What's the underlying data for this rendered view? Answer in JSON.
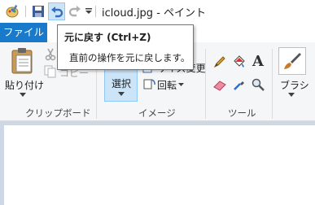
{
  "window": {
    "title": "icloud.jpg - ペイント"
  },
  "quick_access": {
    "icons": [
      "paint-app-icon",
      "save-icon",
      "undo-icon",
      "redo-icon",
      "customize-dropdown-icon"
    ]
  },
  "tabs": {
    "file_label": "ファイル"
  },
  "tooltip": {
    "title": "元に戻す (Ctrl+Z)",
    "description": "直前の操作を元に戻します。"
  },
  "ribbon": {
    "clipboard": {
      "paste_label": "貼り付け",
      "copy_label": "コピー",
      "group_label": "クリップボード"
    },
    "image": {
      "select_label": "選択",
      "resize_label": "サイズ変更",
      "rotate_label": "回転",
      "group_label": "イメージ"
    },
    "tools": {
      "group_label": "ツール"
    },
    "brushes": {
      "label": "ブラシ"
    }
  },
  "colors": {
    "accent": "#1979ca",
    "select_highlight": "#cce4f7",
    "canvas_bg": "#cdd7e6"
  }
}
